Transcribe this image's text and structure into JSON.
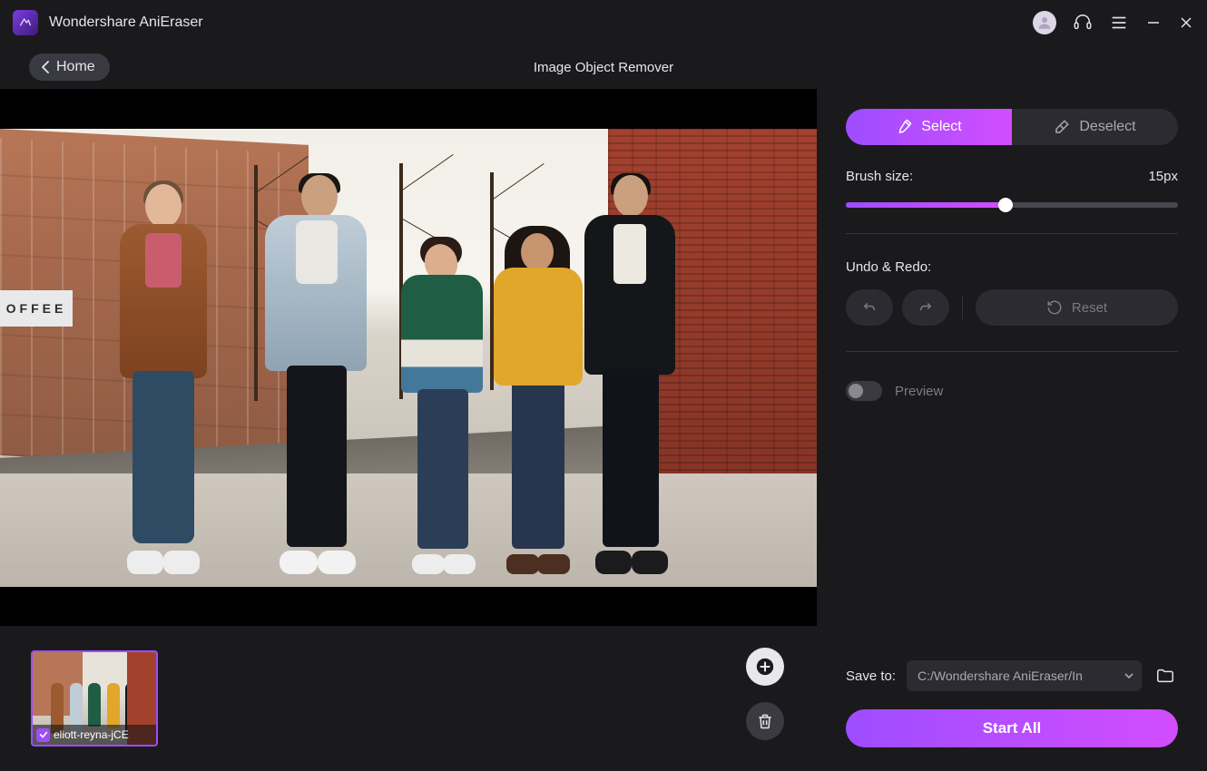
{
  "app": {
    "title": "Wondershare AniEraser"
  },
  "header": {
    "home": "Home",
    "page_title": "Image Object Remover"
  },
  "panel": {
    "select": "Select",
    "deselect": "Deselect",
    "brush_label": "Brush size:",
    "brush_value": "15px",
    "undo_label": "Undo & Redo:",
    "reset": "Reset",
    "preview": "Preview"
  },
  "save": {
    "label": "Save to:",
    "path": "C:/Wondershare AniEraser/In"
  },
  "actions": {
    "start": "Start All"
  },
  "thumbnail": {
    "filename": "eliott-reyna-jCE"
  },
  "scene": {
    "sign": "OFFEE"
  }
}
